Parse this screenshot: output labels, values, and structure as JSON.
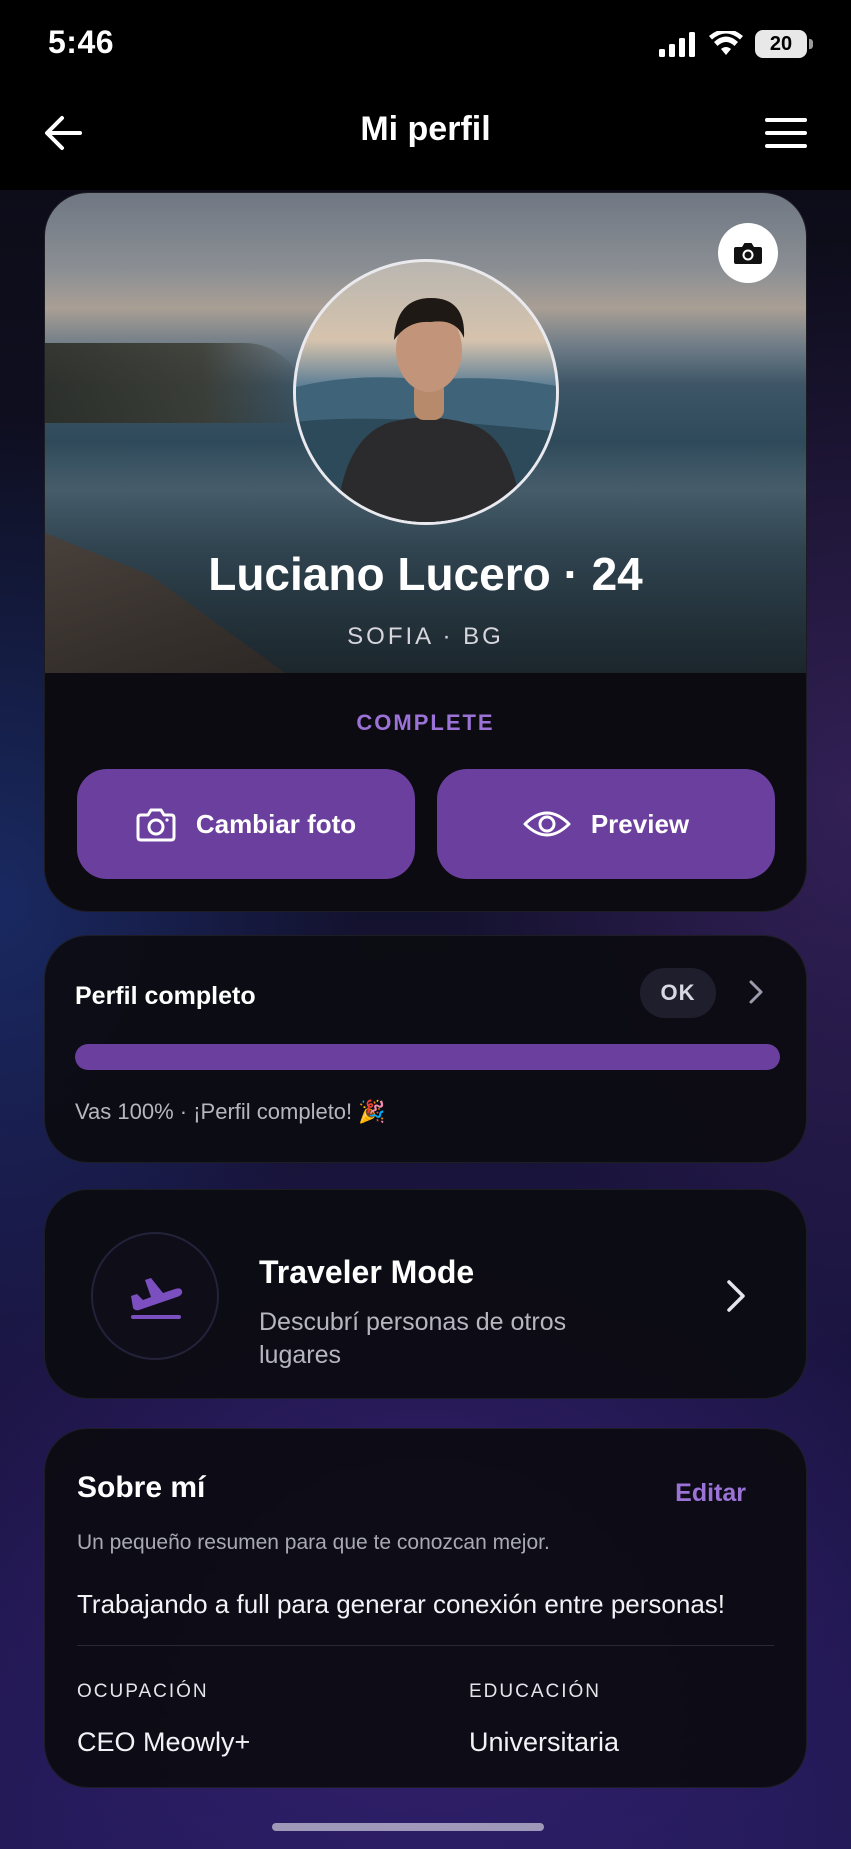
{
  "status_bar": {
    "time": "5:46",
    "battery": "20"
  },
  "header": {
    "title": "Mi perfil"
  },
  "profile": {
    "name": "Luciano Lucero · 24",
    "location": "SOFIA · BG",
    "status": "COMPLETE",
    "change_photo_label": "Cambiar foto",
    "preview_label": "Preview"
  },
  "completion": {
    "title": "Perfil completo",
    "badge": "OK",
    "progress": 1.0,
    "caption": "Vas 100% · ¡Perfil completo! 🎉"
  },
  "traveler": {
    "title": "Traveler Mode",
    "description": "Descubrí personas de otros lugares"
  },
  "about": {
    "title": "Sobre mí",
    "edit_label": "Editar",
    "subtitle": "Un pequeño resumen para que te conozcan mejor.",
    "bio": "Trabajando a full para generar conexión entre personas!",
    "occupation_label": "OCUPACIÓN",
    "occupation_value": "CEO Meowly+",
    "education_label": "EDUCACIÓN",
    "education_value": "Universitaria"
  },
  "colors": {
    "accent": "#6b3f9e",
    "accent_text": "#9b72d6",
    "card_bg": "#0c0c12"
  },
  "icons": [
    "back-arrow-icon",
    "menu-icon",
    "camera-icon",
    "eye-icon",
    "chevron-right-icon",
    "airplane-departure-icon",
    "signal-icon",
    "wifi-icon"
  ]
}
